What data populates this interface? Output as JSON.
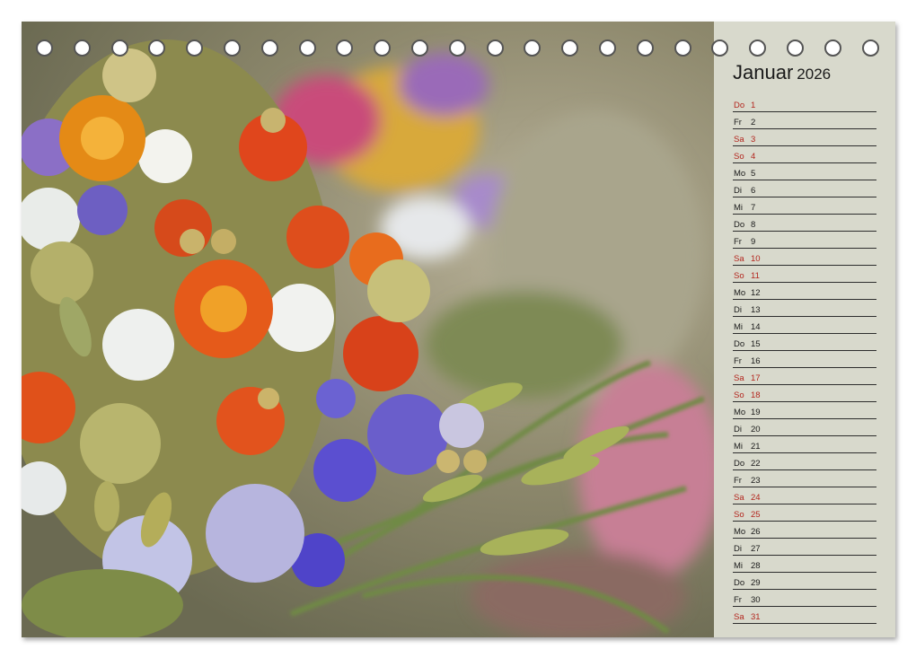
{
  "calendar": {
    "month": "Januar",
    "year": "2026",
    "days": [
      {
        "wd": "Do",
        "d": "1",
        "we": true
      },
      {
        "wd": "Fr",
        "d": "2",
        "we": false
      },
      {
        "wd": "Sa",
        "d": "3",
        "we": true
      },
      {
        "wd": "So",
        "d": "4",
        "we": true
      },
      {
        "wd": "Mo",
        "d": "5",
        "we": false
      },
      {
        "wd": "Di",
        "d": "6",
        "we": false
      },
      {
        "wd": "Mi",
        "d": "7",
        "we": false
      },
      {
        "wd": "Do",
        "d": "8",
        "we": false
      },
      {
        "wd": "Fr",
        "d": "9",
        "we": false
      },
      {
        "wd": "Sa",
        "d": "10",
        "we": true
      },
      {
        "wd": "So",
        "d": "11",
        "we": true
      },
      {
        "wd": "Mo",
        "d": "12",
        "we": false
      },
      {
        "wd": "Di",
        "d": "13",
        "we": false
      },
      {
        "wd": "Mi",
        "d": "14",
        "we": false
      },
      {
        "wd": "Do",
        "d": "15",
        "we": false
      },
      {
        "wd": "Fr",
        "d": "16",
        "we": false
      },
      {
        "wd": "Sa",
        "d": "17",
        "we": true
      },
      {
        "wd": "So",
        "d": "18",
        "we": true
      },
      {
        "wd": "Mo",
        "d": "19",
        "we": false
      },
      {
        "wd": "Di",
        "d": "20",
        "we": false
      },
      {
        "wd": "Mi",
        "d": "21",
        "we": false
      },
      {
        "wd": "Do",
        "d": "22",
        "we": false
      },
      {
        "wd": "Fr",
        "d": "23",
        "we": false
      },
      {
        "wd": "Sa",
        "d": "24",
        "we": true
      },
      {
        "wd": "So",
        "d": "25",
        "we": true
      },
      {
        "wd": "Mo",
        "d": "26",
        "we": false
      },
      {
        "wd": "Di",
        "d": "27",
        "we": false
      },
      {
        "wd": "Mi",
        "d": "28",
        "we": false
      },
      {
        "wd": "Do",
        "d": "29",
        "we": false
      },
      {
        "wd": "Fr",
        "d": "30",
        "we": false
      },
      {
        "wd": "Sa",
        "d": "31",
        "we": true
      }
    ]
  },
  "colors": {
    "weekend": "#b3261e",
    "panel": "#d8d9cc"
  },
  "binding": {
    "ring_count": 23
  }
}
